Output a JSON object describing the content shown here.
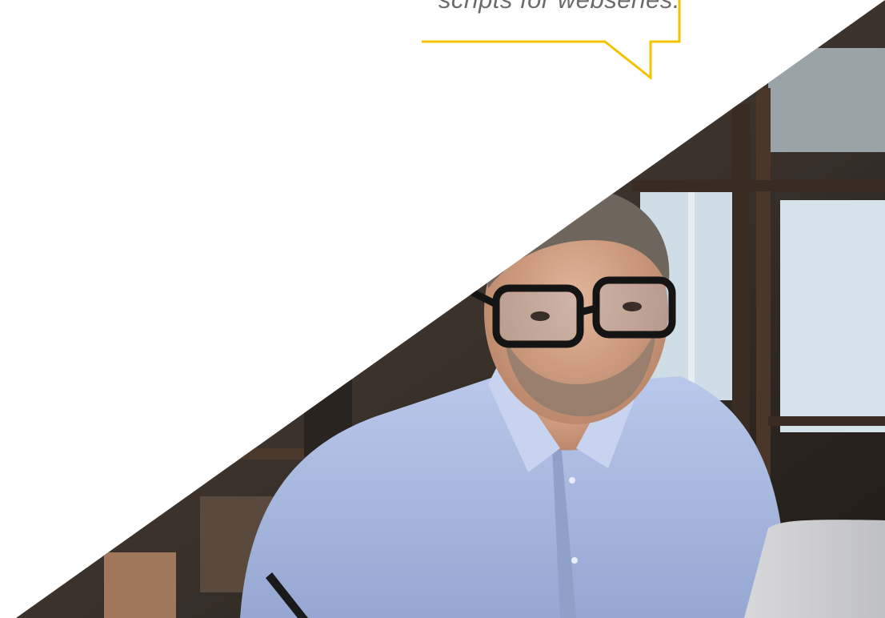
{
  "quote": {
    "text": "scripts for webseries."
  },
  "colors": {
    "bubble_outline": "#f2c300",
    "quote_text": "#6b6b6b",
    "background": "#ffffff"
  },
  "image": {
    "subject": "man-with-glasses-working-at-laptop-photo"
  }
}
